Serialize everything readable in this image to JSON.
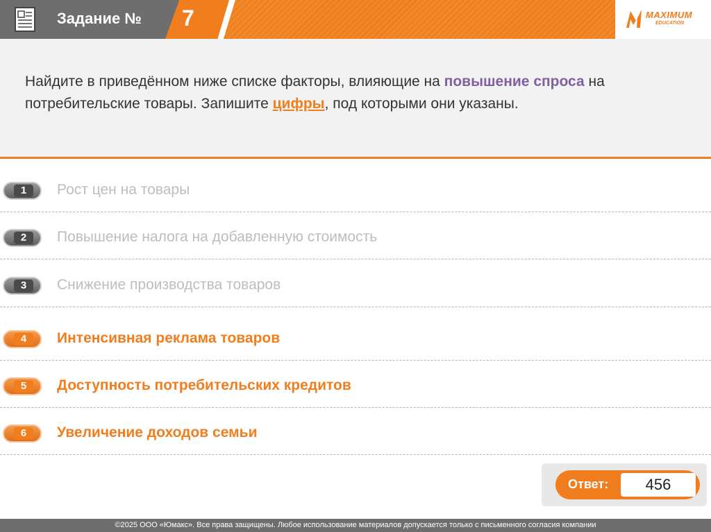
{
  "header": {
    "task_label": "Задание №",
    "task_number": "7",
    "logo_text": "MAXIMUM",
    "logo_sub": "EDUCATION"
  },
  "question": {
    "part1": "Найдите в приведённом ниже списке факторы, влияющие на ",
    "highlight1": "повышение спроса",
    "part2": " на потребительские товары. Запишите ",
    "highlight2": "цифры",
    "part3": ", под которыми они указаны."
  },
  "options": [
    {
      "num": "1",
      "text": "Рост цен на товары"
    },
    {
      "num": "2",
      "text": "Повышение налога на добавленную стоимость"
    },
    {
      "num": "3",
      "text": "Снижение производства товаров"
    },
    {
      "num": "4",
      "text": "Интенсивная реклама товаров"
    },
    {
      "num": "5",
      "text": "Доступность потребительских кредитов"
    },
    {
      "num": "6",
      "text": "Увеличение доходов семьи"
    }
  ],
  "answer": {
    "label": "Ответ:",
    "value": "456"
  },
  "footer": {
    "text": "©2025 ООО «Юмакс». Все права защищены. Любое использование материалов допускается только с  письменного согласия компании"
  },
  "colors": {
    "accent": "#f07d1e",
    "header_gray": "#6e6e6e",
    "highlight_purple": "#8060a0"
  },
  "icons": {
    "doc": "document-icon",
    "logo": "maximum-logo-icon"
  }
}
